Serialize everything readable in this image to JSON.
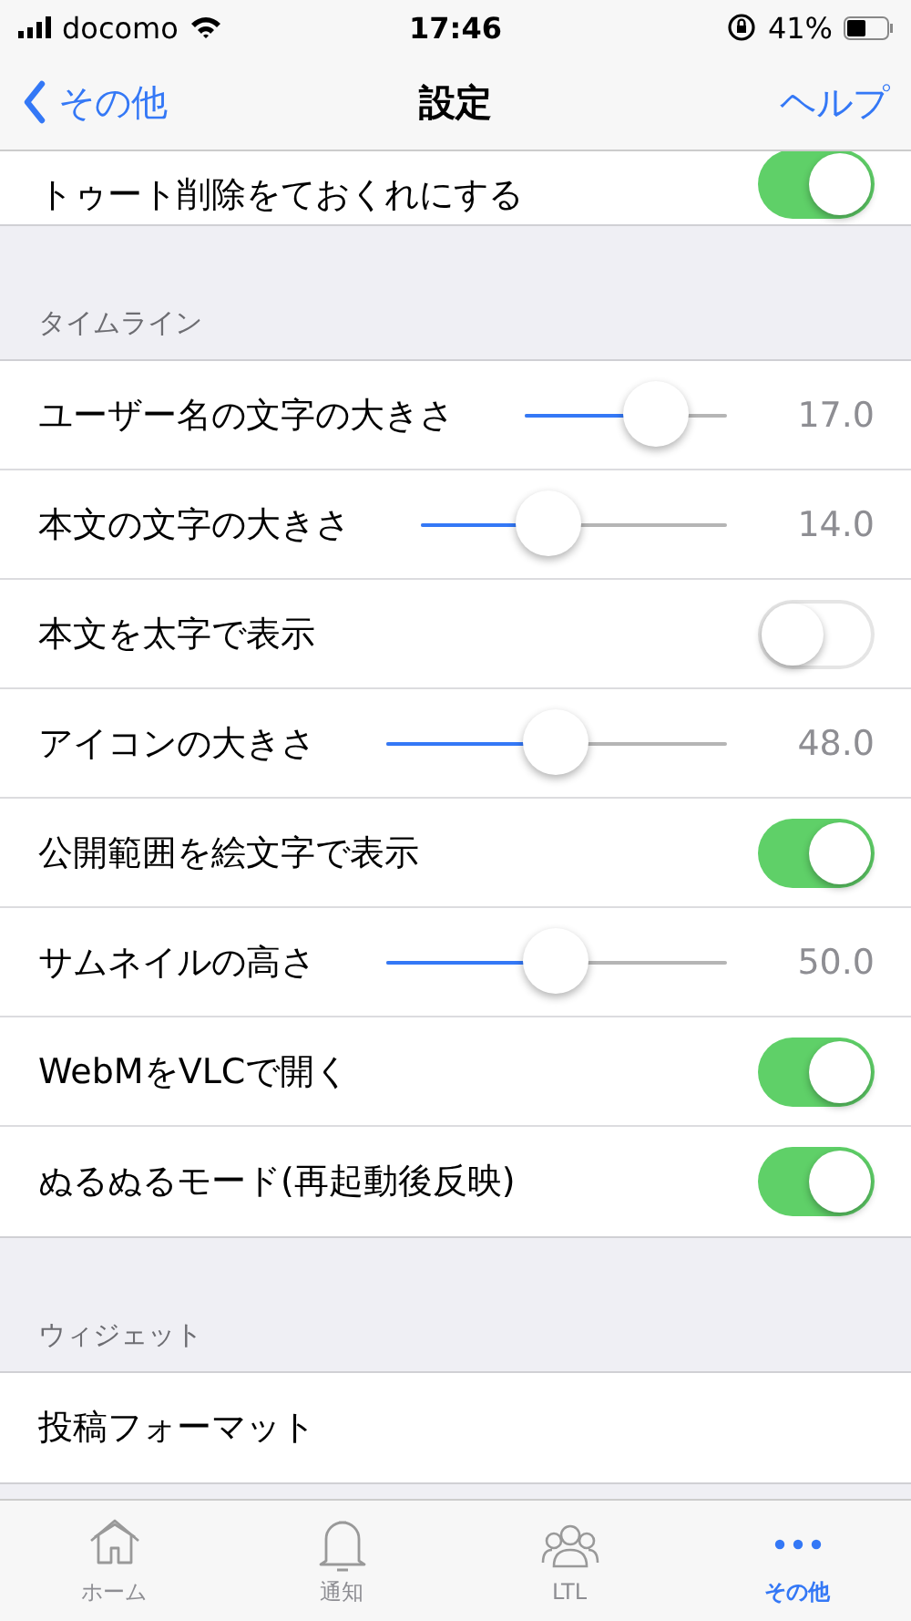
{
  "status_bar": {
    "carrier": "docomo",
    "time": "17:46",
    "battery": "41%"
  },
  "nav": {
    "back": "その他",
    "title": "設定",
    "action": "ヘルプ"
  },
  "sections": [
    {
      "items": [
        {
          "kind": "toggle",
          "label": "トゥート削除をておくれにする",
          "on": true
        }
      ]
    },
    {
      "header": "タイムライン",
      "items": [
        {
          "kind": "slider",
          "label": "ユーザー名の文字の大きさ",
          "level": 0.65,
          "reading": "17.0"
        },
        {
          "kind": "slider",
          "label": "本文の文字の大きさ",
          "level": 0.42,
          "reading": "14.0"
        },
        {
          "kind": "toggle",
          "label": "本文を太字で表示",
          "on": false
        },
        {
          "kind": "slider",
          "label": "アイコンの大きさ",
          "level": 0.5,
          "reading": "48.0"
        },
        {
          "kind": "toggle",
          "label": "公開範囲を絵文字で表示",
          "on": true
        },
        {
          "kind": "slider",
          "label": "サムネイルの高さ",
          "level": 0.5,
          "reading": "50.0"
        },
        {
          "kind": "toggle",
          "label": "WebMをVLCで開く",
          "on": true
        },
        {
          "kind": "toggle",
          "label": "ぬるぬるモード(再起動後反映)",
          "on": true
        }
      ]
    },
    {
      "header": "ウィジェット",
      "items": [
        {
          "kind": "link",
          "label": "投稿フォーマット"
        }
      ]
    }
  ],
  "tabs": [
    {
      "label": "ホーム",
      "selected": false
    },
    {
      "label": "通知",
      "selected": false
    },
    {
      "label": "LTL",
      "selected": false
    },
    {
      "label": "その他",
      "selected": true
    }
  ]
}
